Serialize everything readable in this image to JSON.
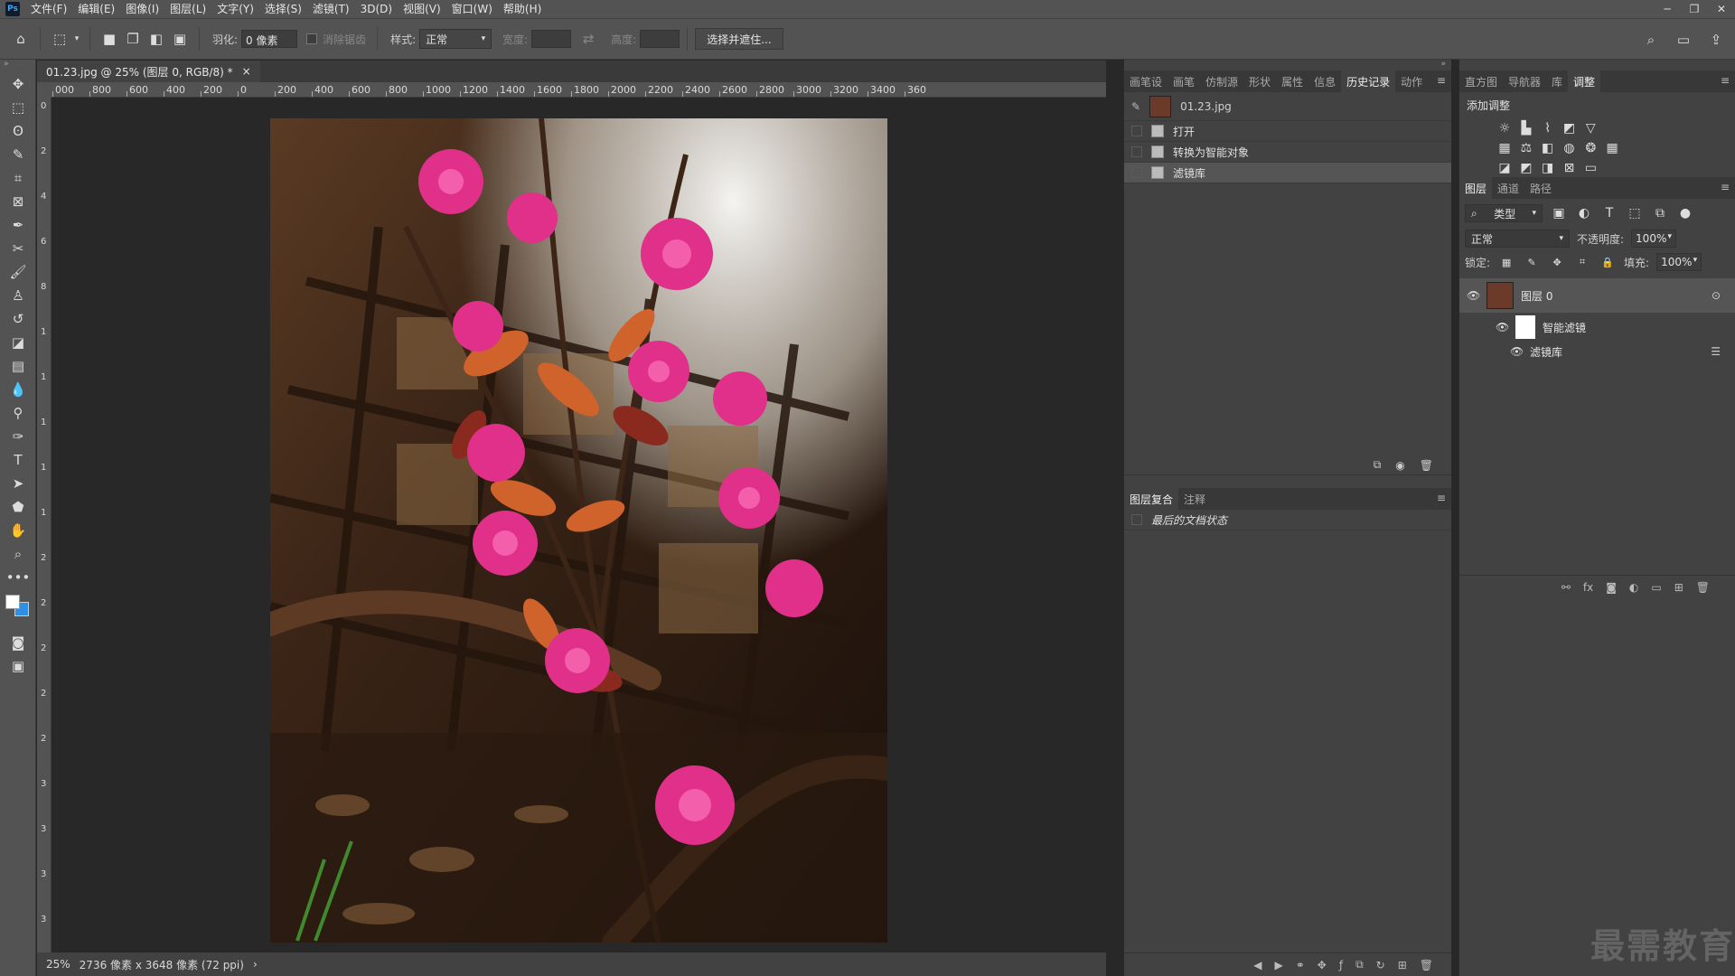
{
  "app": {
    "logo": "Ps"
  },
  "menu": [
    "文件(F)",
    "编辑(E)",
    "图像(I)",
    "图层(L)",
    "文字(Y)",
    "选择(S)",
    "滤镜(T)",
    "3D(D)",
    "视图(V)",
    "窗口(W)",
    "帮助(H)"
  ],
  "window_controls": {
    "minimize": "─",
    "restore": "❐",
    "close": "✕"
  },
  "options_bar": {
    "feather_label": "羽化:",
    "feather_value": "0 像素",
    "antialias_label": "消除锯齿",
    "style_label": "样式:",
    "style_value": "正常",
    "width_label": "宽度:",
    "height_label": "高度:",
    "select_mask_button": "选择并遮住..."
  },
  "document": {
    "tab_title": "01.23.jpg @ 25% (图层 0, RGB/8) *",
    "close": "×"
  },
  "ruler_top_labels": [
    "000",
    "800",
    "600",
    "400",
    "200",
    "0",
    "200",
    "400",
    "600",
    "800",
    "1000",
    "1200",
    "1400",
    "1600",
    "1800",
    "2000",
    "2200",
    "2400",
    "2600",
    "2800",
    "3000",
    "3200",
    "3400",
    "360"
  ],
  "ruler_left_labels": [
    "0",
    "2",
    "4",
    "6",
    "8",
    "1",
    "1",
    "1",
    "1",
    "1",
    "2",
    "2",
    "2",
    "2",
    "2",
    "3",
    "3",
    "3",
    "3"
  ],
  "status": {
    "zoom": "25%",
    "info": "2736 像素 x 3648 像素 (72 ppi)",
    "arrow": "›"
  },
  "history_panel": {
    "tabs": [
      "画笔设",
      "画笔",
      "仿制源",
      "形状",
      "属性",
      "信息",
      "历史记录",
      "动作"
    ],
    "active_tab": "历史记录",
    "snapshot": "01.23.jpg",
    "items": [
      "打开",
      "转换为智能对象",
      "滤镜库"
    ],
    "selected_item": "滤镜库"
  },
  "layer_comps_panel": {
    "tabs": [
      "图层复合",
      "注释"
    ],
    "active_tab": "图层复合",
    "items": [
      "最后的文档状态"
    ]
  },
  "adjust_panel": {
    "tabs": [
      "直方图",
      "导航器",
      "库",
      "调整"
    ],
    "active_tab": "调整",
    "title": "添加调整"
  },
  "layers_panel": {
    "tabs": [
      "图层",
      "通道",
      "路径"
    ],
    "active_tab": "图层",
    "filter_label": "类型",
    "blend_mode": "正常",
    "opacity_label": "不透明度:",
    "opacity_value": "100%",
    "lock_label": "锁定:",
    "fill_label": "填充:",
    "fill_value": "100%",
    "layers": [
      {
        "name": "图层 0"
      },
      {
        "name": "智能滤镜"
      },
      {
        "name": "滤镜库"
      }
    ]
  },
  "watermark": "最需教育"
}
